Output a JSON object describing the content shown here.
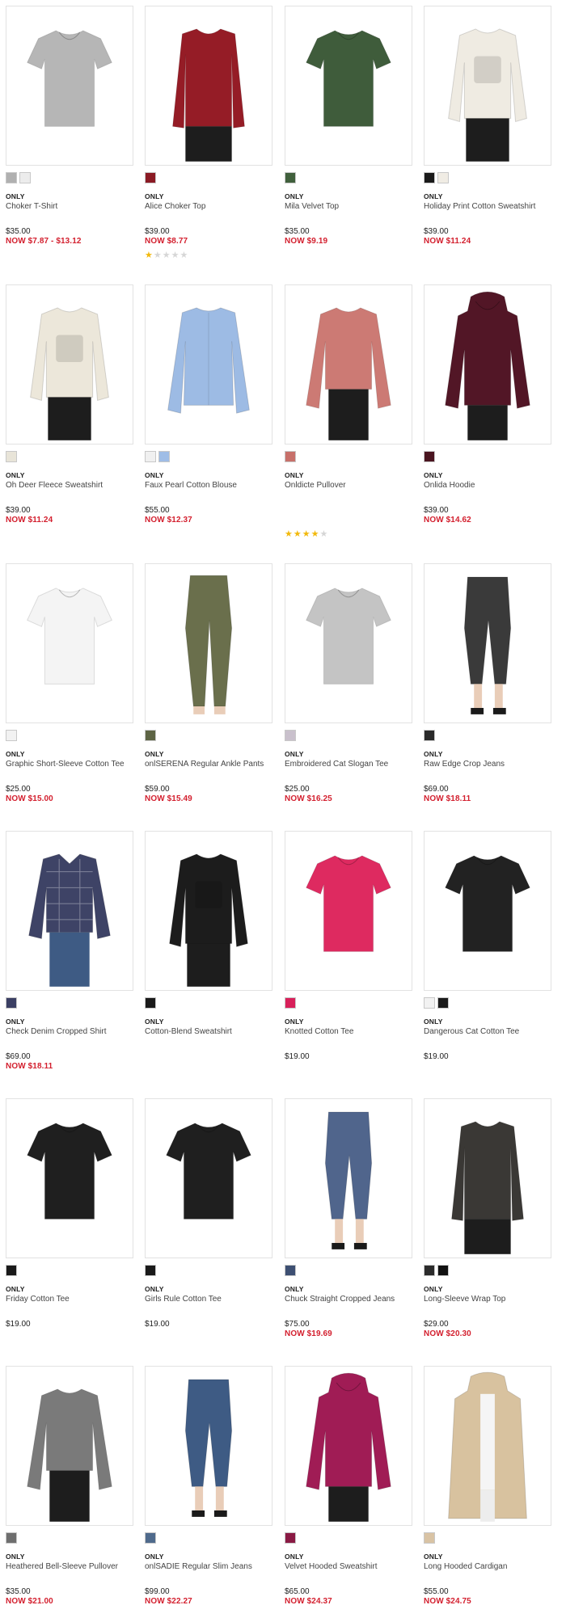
{
  "products": [
    {
      "brand": "ONLY",
      "name": "Choker T-Shirt",
      "original_price": "$35.00",
      "now_price": "NOW $7.87 - $13.12",
      "swatches": [
        "#b0b0b0",
        "#ececec"
      ],
      "icon": "tshirt-icon",
      "garment_color": "#b6b6b6",
      "rating": null
    },
    {
      "brand": "ONLY",
      "name": "Alice Choker Top",
      "original_price": "$39.00",
      "now_price": "NOW $8.77",
      "swatches": [
        "#8b1a24"
      ],
      "icon": "top-icon",
      "garment_color": "#951c26",
      "rating": 1
    },
    {
      "brand": "ONLY",
      "name": "Mila Velvet Top",
      "original_price": "$35.00",
      "now_price": "NOW $9.19",
      "swatches": [
        "#40603c"
      ],
      "icon": "tshirt-icon",
      "garment_color": "#3f5c3b",
      "rating": null
    },
    {
      "brand": "ONLY",
      "name": "Holiday Print Cotton Sweatshirt",
      "original_price": "$39.00",
      "now_price": "NOW $11.24",
      "swatches": [
        "#1a1a1a",
        "#f0ece4"
      ],
      "icon": "sweatshirt-icon",
      "garment_color": "#efebe2",
      "rating": null
    },
    {
      "brand": "ONLY",
      "name": "Oh Deer Fleece Sweatshirt",
      "original_price": "$39.00",
      "now_price": "NOW $11.24",
      "swatches": [
        "#e8e4d8"
      ],
      "icon": "sweatshirt-icon",
      "garment_color": "#ece7da",
      "rating": null
    },
    {
      "brand": "ONLY",
      "name": "Faux Pearl Cotton Blouse",
      "original_price": "$55.00",
      "now_price": "NOW $12.37",
      "swatches": [
        "#f0f0f0",
        "#9fbde6"
      ],
      "icon": "blouse-icon",
      "garment_color": "#9dbbe4",
      "rating": null
    },
    {
      "brand": "ONLY",
      "name": "Onldicte Pullover",
      "original_price": "",
      "now_price": "",
      "swatches": [
        "#c7706a"
      ],
      "icon": "sweater-icon",
      "garment_color": "#cc7a74",
      "rating": 4
    },
    {
      "brand": "ONLY",
      "name": "Onlida Hoodie",
      "original_price": "$39.00",
      "now_price": "NOW $14.62",
      "swatches": [
        "#4a1520"
      ],
      "icon": "hoodie-icon",
      "garment_color": "#521626",
      "rating": null
    },
    {
      "brand": "ONLY",
      "name": "Graphic Short-Sleeve Cotton Tee",
      "original_price": "$25.00",
      "now_price": "NOW $15.00",
      "swatches": [
        "#f2f2f2"
      ],
      "icon": "tshirt-icon",
      "garment_color": "#f4f4f4",
      "rating": null
    },
    {
      "brand": "ONLY",
      "name": "onlSERENA Regular Ankle Pants",
      "original_price": "$59.00",
      "now_price": "NOW $15.49",
      "swatches": [
        "#5d6444"
      ],
      "icon": "pants-icon",
      "garment_color": "#6a6f4c",
      "rating": null
    },
    {
      "brand": "ONLY",
      "name": "Embroidered Cat Slogan Tee",
      "original_price": "$25.00",
      "now_price": "NOW $16.25",
      "swatches": [
        "#c9c0cc"
      ],
      "icon": "tshirt-icon",
      "garment_color": "#c4c4c4",
      "rating": null
    },
    {
      "brand": "ONLY",
      "name": "Raw Edge Crop Jeans",
      "original_price": "$69.00",
      "now_price": "NOW $18.11",
      "swatches": [
        "#2a2a2a"
      ],
      "icon": "jeans-icon",
      "garment_color": "#3a3a3a",
      "rating": null
    },
    {
      "brand": "ONLY",
      "name": "Check Denim Cropped Shirt",
      "original_price": "$69.00",
      "now_price": "NOW $18.11",
      "swatches": [
        "#3b3f63"
      ],
      "icon": "shirt-icon",
      "garment_color": "#3e4366",
      "rating": null
    },
    {
      "brand": "ONLY",
      "name": "Cotton-Blend Sweatshirt",
      "original_price": "",
      "now_price": "",
      "swatches": [
        "#1a1a1a"
      ],
      "icon": "sweatshirt-icon",
      "garment_color": "#1c1c1c",
      "rating": null
    },
    {
      "brand": "ONLY",
      "name": "Knotted Cotton Tee",
      "original_price": "$19.00",
      "now_price": "",
      "swatches": [
        "#d8205a"
      ],
      "icon": "tshirt-icon",
      "garment_color": "#de2a60",
      "rating": null
    },
    {
      "brand": "ONLY",
      "name": "Dangerous Cat Cotton Tee",
      "original_price": "$19.00",
      "now_price": "",
      "swatches": [
        "#f2f2f2",
        "#1a1a1a"
      ],
      "icon": "tshirt-icon",
      "garment_color": "#222222",
      "rating": null
    },
    {
      "brand": "ONLY",
      "name": "Friday Cotton Tee",
      "original_price": "$19.00",
      "now_price": "",
      "swatches": [
        "#1a1a1a"
      ],
      "icon": "tshirt-icon",
      "garment_color": "#1f1f1f",
      "rating": null
    },
    {
      "brand": "ONLY",
      "name": "Girls Rule Cotton Tee",
      "original_price": "$19.00",
      "now_price": "",
      "swatches": [
        "#1a1a1a"
      ],
      "icon": "tshirt-icon",
      "garment_color": "#1f1f1f",
      "rating": null
    },
    {
      "brand": "ONLY",
      "name": "Chuck Straight Cropped Jeans",
      "original_price": "$75.00",
      "now_price": "NOW $19.69",
      "swatches": [
        "#3d4f72"
      ],
      "icon": "jeans-icon",
      "garment_color": "#50658c",
      "rating": null
    },
    {
      "brand": "ONLY",
      "name": "Long-Sleeve Wrap Top",
      "original_price": "$29.00",
      "now_price": "NOW $20.30",
      "swatches": [
        "#2b2b2b",
        "#111111"
      ],
      "icon": "top-icon",
      "garment_color": "#3a3835",
      "rating": null
    },
    {
      "brand": "ONLY",
      "name": "Heathered Bell-Sleeve Pullover",
      "original_price": "$35.00",
      "now_price": "NOW $21.00",
      "swatches": [
        "#6e6e6e"
      ],
      "icon": "sweater-icon",
      "garment_color": "#7a7a7a",
      "rating": null
    },
    {
      "brand": "ONLY",
      "name": "onlSADIE Regular Slim Jeans",
      "original_price": "$99.00",
      "now_price": "NOW $22.27",
      "swatches": [
        "#4f6a8c"
      ],
      "icon": "jeans-icon",
      "garment_color": "#3e5b84",
      "rating": null
    },
    {
      "brand": "ONLY",
      "name": "Velvet Hooded Sweatshirt",
      "original_price": "$65.00",
      "now_price": "NOW $24.37",
      "swatches": [
        "#8a1a44"
      ],
      "icon": "hoodie-icon",
      "garment_color": "#a01c55",
      "rating": null
    },
    {
      "brand": "ONLY",
      "name": "Long Hooded Cardigan",
      "original_price": "$55.00",
      "now_price": "NOW $24.75",
      "swatches": [
        "#d9c3a4"
      ],
      "icon": "cardigan-icon",
      "garment_color": "#d8c29f",
      "rating": null
    }
  ],
  "rating_scale": 5,
  "colors": {
    "sale_price": "#d31f2e",
    "star_filled": "#f2b90c",
    "star_empty": "#d6d6d6"
  }
}
